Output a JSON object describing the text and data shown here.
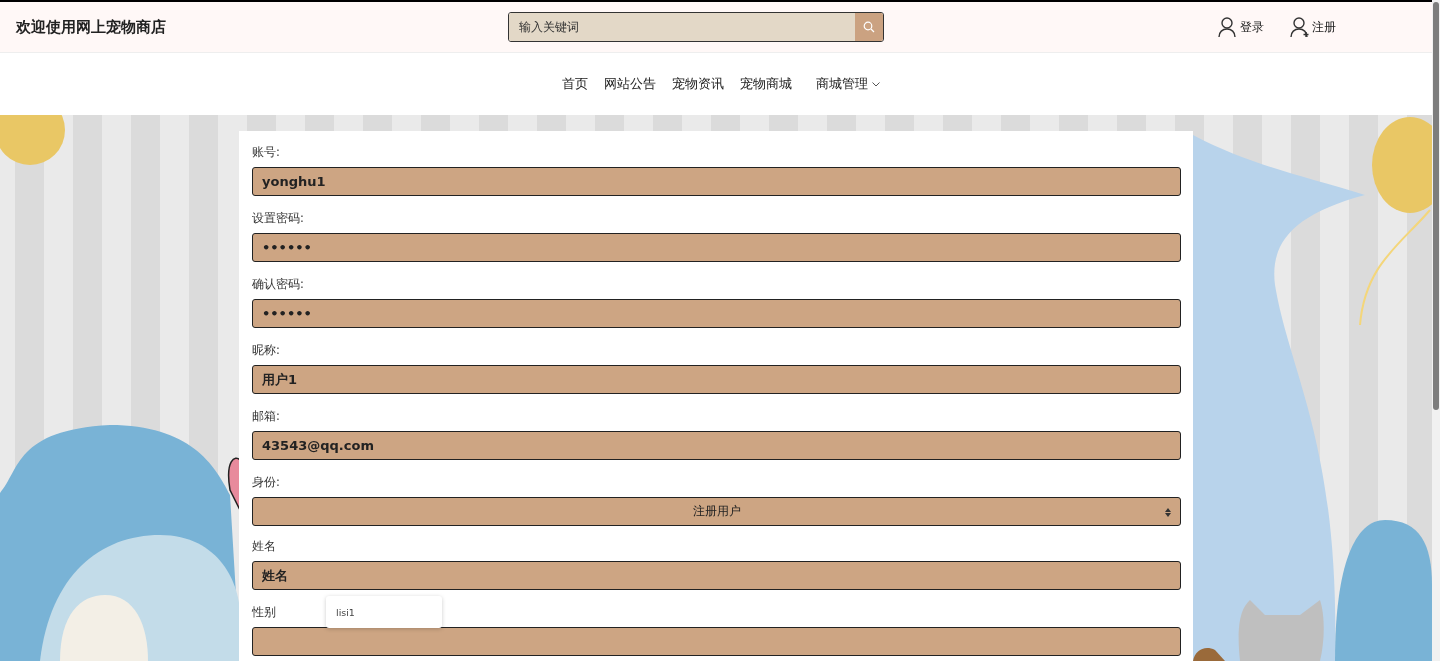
{
  "header": {
    "title": "欢迎使用网上宠物商店",
    "search": {
      "placeholder": "输入关键词"
    },
    "links": [
      {
        "label": "登录",
        "kind": "login"
      },
      {
        "label": "注册",
        "kind": "register"
      }
    ]
  },
  "nav": [
    {
      "label": "首页",
      "kind": "link"
    },
    {
      "label": "网站公告",
      "kind": "link"
    },
    {
      "label": "宠物资讯",
      "kind": "link"
    },
    {
      "label": "宠物商城",
      "kind": "link"
    },
    {
      "label": "商城管理",
      "kind": "dropdown"
    }
  ],
  "form": {
    "fields": [
      {
        "label": "账号:",
        "kind": "text",
        "value": "yonghu1"
      },
      {
        "label": "设置密码:",
        "kind": "text",
        "value": "••••••"
      },
      {
        "label": "确认密码:",
        "kind": "text",
        "value": "••••••"
      },
      {
        "label": "昵称:",
        "kind": "text",
        "value": "用户1"
      },
      {
        "label": "邮箱:",
        "kind": "text",
        "value": "43543@qq.com"
      },
      {
        "label": "身份:",
        "kind": "select",
        "value": "注册用户"
      },
      {
        "label": "姓名",
        "kind": "text",
        "value": "姓名",
        "suggestions": [
          "lisi1"
        ]
      },
      {
        "label": "性别",
        "kind": "text"
      }
    ]
  }
}
